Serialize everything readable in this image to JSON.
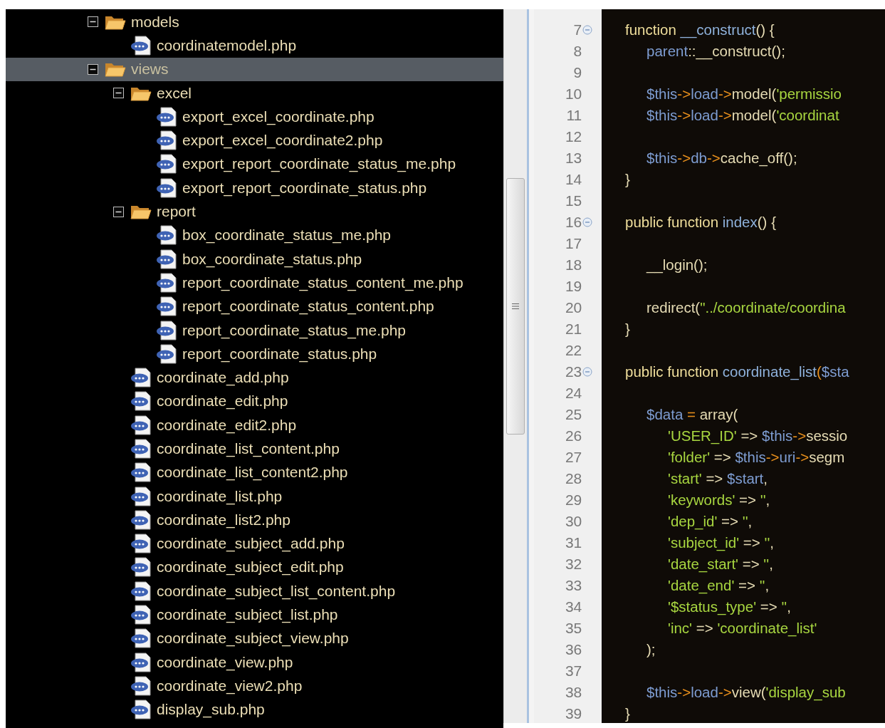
{
  "tree": [
    {
      "name": "models",
      "kind": "folder",
      "expanded": true,
      "selected": false,
      "children": [
        {
          "name": "coordinatemodel.php",
          "kind": "file",
          "selected": false
        }
      ]
    },
    {
      "name": "views",
      "kind": "folder",
      "expanded": true,
      "selected": true,
      "children": [
        {
          "name": "excel",
          "kind": "folder",
          "expanded": true,
          "selected": false,
          "children": [
            {
              "name": "export_excel_coordinate.php",
              "kind": "file",
              "selected": false
            },
            {
              "name": "export_excel_coordinate2.php",
              "kind": "file",
              "selected": false
            },
            {
              "name": "export_report_coordinate_status_me.php",
              "kind": "file",
              "selected": false
            },
            {
              "name": "export_report_coordinate_status.php",
              "kind": "file",
              "selected": false
            }
          ]
        },
        {
          "name": "report",
          "kind": "folder",
          "expanded": true,
          "selected": false,
          "children": [
            {
              "name": "box_coordinate_status_me.php",
              "kind": "file",
              "selected": false
            },
            {
              "name": "box_coordinate_status.php",
              "kind": "file",
              "selected": false
            },
            {
              "name": "report_coordinate_status_content_me.php",
              "kind": "file",
              "selected": false
            },
            {
              "name": "report_coordinate_status_content.php",
              "kind": "file",
              "selected": false
            },
            {
              "name": "report_coordinate_status_me.php",
              "kind": "file",
              "selected": false
            },
            {
              "name": "report_coordinate_status.php",
              "kind": "file",
              "selected": false
            }
          ]
        },
        {
          "name": "coordinate_add.php",
          "kind": "file",
          "selected": false
        },
        {
          "name": "coordinate_edit.php",
          "kind": "file",
          "selected": false
        },
        {
          "name": "coordinate_edit2.php",
          "kind": "file",
          "selected": false
        },
        {
          "name": "coordinate_list_content.php",
          "kind": "file",
          "selected": false
        },
        {
          "name": "coordinate_list_content2.php",
          "kind": "file",
          "selected": false
        },
        {
          "name": "coordinate_list.php",
          "kind": "file",
          "selected": false
        },
        {
          "name": "coordinate_list2.php",
          "kind": "file",
          "selected": false
        },
        {
          "name": "coordinate_subject_add.php",
          "kind": "file",
          "selected": false
        },
        {
          "name": "coordinate_subject_edit.php",
          "kind": "file",
          "selected": false
        },
        {
          "name": "coordinate_subject_list_content.php",
          "kind": "file",
          "selected": false
        },
        {
          "name": "coordinate_subject_list.php",
          "kind": "file",
          "selected": false
        },
        {
          "name": "coordinate_subject_view.php",
          "kind": "file",
          "selected": false
        },
        {
          "name": "coordinate_view.php",
          "kind": "file",
          "selected": false
        },
        {
          "name": "coordinate_view2.php",
          "kind": "file",
          "selected": false
        },
        {
          "name": "display_sub.php",
          "kind": "file",
          "selected": false
        }
      ]
    }
  ],
  "code_lines": [
    {
      "number": "7",
      "fold": true,
      "tokens": [
        {
          "kind": "kw",
          "text": "function "
        },
        {
          "kind": "fn",
          "text": "__construct"
        },
        {
          "kind": "p",
          "text": "() {"
        }
      ]
    },
    {
      "number": "8",
      "fold": false,
      "tokens": [
        {
          "kind": "var",
          "text": "\tparent"
        },
        {
          "kind": "p",
          "text": "::__construct();"
        }
      ]
    },
    {
      "number": "9",
      "fold": false
    },
    {
      "number": "10",
      "fold": false,
      "tokens": [
        {
          "kind": "var",
          "text": "\t$this"
        },
        {
          "kind": "op",
          "text": "->"
        },
        {
          "kind": "var",
          "text": "load"
        },
        {
          "kind": "op",
          "text": "->"
        },
        {
          "kind": "p",
          "text": "model("
        },
        {
          "kind": "str",
          "text": "'permissio"
        }
      ]
    },
    {
      "number": "11",
      "fold": false,
      "tokens": [
        {
          "kind": "var",
          "text": "\t$this"
        },
        {
          "kind": "op",
          "text": "->"
        },
        {
          "kind": "var",
          "text": "load"
        },
        {
          "kind": "op",
          "text": "->"
        },
        {
          "kind": "p",
          "text": "model("
        },
        {
          "kind": "str",
          "text": "'coordinat"
        }
      ]
    },
    {
      "number": "12",
      "fold": false
    },
    {
      "number": "13",
      "fold": false,
      "tokens": [
        {
          "kind": "var",
          "text": "\t$this"
        },
        {
          "kind": "op",
          "text": "->"
        },
        {
          "kind": "var",
          "text": "db"
        },
        {
          "kind": "op",
          "text": "->"
        },
        {
          "kind": "p",
          "text": "cache_off();"
        }
      ]
    },
    {
      "number": "14",
      "fold": false,
      "tokens": [
        {
          "kind": "p",
          "text": "}"
        }
      ]
    },
    {
      "number": "15",
      "fold": false
    },
    {
      "number": "16",
      "fold": true,
      "tokens": [
        {
          "kind": "kw",
          "text": "public function "
        },
        {
          "kind": "fn",
          "text": "index"
        },
        {
          "kind": "p",
          "text": "() {"
        }
      ]
    },
    {
      "number": "17",
      "fold": false
    },
    {
      "number": "18",
      "fold": false,
      "tokens": [
        {
          "kind": "p",
          "text": "\t__login();"
        }
      ]
    },
    {
      "number": "19",
      "fold": false
    },
    {
      "number": "20",
      "fold": false,
      "tokens": [
        {
          "kind": "p",
          "text": "\tredirect("
        },
        {
          "kind": "str",
          "text": "\"../coordinate/coordina"
        }
      ]
    },
    {
      "number": "21",
      "fold": false,
      "tokens": [
        {
          "kind": "p",
          "text": "}"
        }
      ]
    },
    {
      "number": "22",
      "fold": false
    },
    {
      "number": "23",
      "fold": true,
      "tokens": [
        {
          "kind": "kw",
          "text": "public function "
        },
        {
          "kind": "fn",
          "text": "coordinate_list"
        },
        {
          "kind": "op",
          "text": "("
        },
        {
          "kind": "var",
          "text": "$sta"
        }
      ]
    },
    {
      "number": "24",
      "fold": false
    },
    {
      "number": "25",
      "fold": false,
      "tokens": [
        {
          "kind": "var",
          "text": "\t$data "
        },
        {
          "kind": "op",
          "text": "= "
        },
        {
          "kind": "p",
          "text": "array("
        }
      ]
    },
    {
      "number": "26",
      "fold": false,
      "tokens": [
        {
          "kind": "str",
          "text": "\t\t'USER_ID'"
        },
        {
          "kind": "p",
          "text": " => "
        },
        {
          "kind": "var",
          "text": "$this"
        },
        {
          "kind": "op",
          "text": "->"
        },
        {
          "kind": "p",
          "text": "sessio"
        }
      ]
    },
    {
      "number": "27",
      "fold": false,
      "tokens": [
        {
          "kind": "str",
          "text": "\t\t'folder'"
        },
        {
          "kind": "p",
          "text": " => "
        },
        {
          "kind": "var",
          "text": "$this"
        },
        {
          "kind": "op",
          "text": "->"
        },
        {
          "kind": "var",
          "text": "uri"
        },
        {
          "kind": "op",
          "text": "->"
        },
        {
          "kind": "p",
          "text": "segm"
        }
      ]
    },
    {
      "number": "28",
      "fold": false,
      "tokens": [
        {
          "kind": "str",
          "text": "\t\t'start'"
        },
        {
          "kind": "p",
          "text": " => "
        },
        {
          "kind": "var",
          "text": "$start"
        },
        {
          "kind": "p",
          "text": ","
        }
      ]
    },
    {
      "number": "29",
      "fold": false,
      "tokens": [
        {
          "kind": "str",
          "text": "\t\t'keywords'"
        },
        {
          "kind": "p",
          "text": " => "
        },
        {
          "kind": "str",
          "text": "''"
        },
        {
          "kind": "p",
          "text": ","
        }
      ]
    },
    {
      "number": "30",
      "fold": false,
      "tokens": [
        {
          "kind": "str",
          "text": "\t\t'dep_id'"
        },
        {
          "kind": "p",
          "text": " => "
        },
        {
          "kind": "str",
          "text": "''"
        },
        {
          "kind": "p",
          "text": ","
        }
      ]
    },
    {
      "number": "31",
      "fold": false,
      "tokens": [
        {
          "kind": "str",
          "text": "\t\t'subject_id'"
        },
        {
          "kind": "p",
          "text": " => "
        },
        {
          "kind": "str",
          "text": "''"
        },
        {
          "kind": "p",
          "text": ","
        }
      ]
    },
    {
      "number": "32",
      "fold": false,
      "tokens": [
        {
          "kind": "str",
          "text": "\t\t'date_start'"
        },
        {
          "kind": "p",
          "text": " => "
        },
        {
          "kind": "str",
          "text": "''"
        },
        {
          "kind": "p",
          "text": ","
        }
      ]
    },
    {
      "number": "33",
      "fold": false,
      "tokens": [
        {
          "kind": "str",
          "text": "\t\t'date_end'"
        },
        {
          "kind": "p",
          "text": " => "
        },
        {
          "kind": "str",
          "text": "''"
        },
        {
          "kind": "p",
          "text": ","
        }
      ]
    },
    {
      "number": "34",
      "fold": false,
      "tokens": [
        {
          "kind": "str",
          "text": "\t\t'$status_type'"
        },
        {
          "kind": "p",
          "text": " => "
        },
        {
          "kind": "str",
          "text": "''"
        },
        {
          "kind": "p",
          "text": ","
        }
      ]
    },
    {
      "number": "35",
      "fold": false,
      "tokens": [
        {
          "kind": "str",
          "text": "\t\t'inc'"
        },
        {
          "kind": "p",
          "text": " => "
        },
        {
          "kind": "str",
          "text": "'coordinate_list'"
        }
      ]
    },
    {
      "number": "36",
      "fold": false,
      "tokens": [
        {
          "kind": "p",
          "text": "\t);"
        }
      ]
    },
    {
      "number": "37",
      "fold": false
    },
    {
      "number": "38",
      "fold": false,
      "tokens": [
        {
          "kind": "var",
          "text": "\t$this"
        },
        {
          "kind": "op",
          "text": "->"
        },
        {
          "kind": "var",
          "text": "load"
        },
        {
          "kind": "op",
          "text": "->"
        },
        {
          "kind": "p",
          "text": "view("
        },
        {
          "kind": "str",
          "text": "'display_sub"
        }
      ]
    },
    {
      "number": "39",
      "fold": false,
      "tokens": [
        {
          "kind": "p",
          "text": "}"
        }
      ]
    }
  ]
}
